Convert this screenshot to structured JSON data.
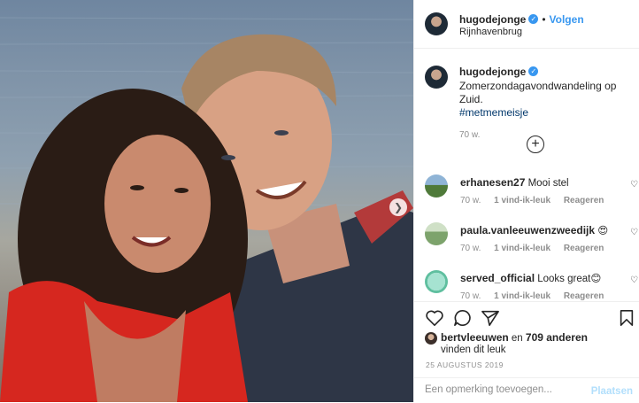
{
  "post": {
    "username": "hugodejonge",
    "verified": true,
    "follow_label": "Volgen",
    "location": "Rijnhavenbrug",
    "caption": "Zomerzondagavondwandeling op Zuid.",
    "hashtag": "#metmemeisje",
    "age": "70 w."
  },
  "comments": [
    {
      "username": "erhanesen27",
      "text": "Mooi stel",
      "age": "70 w.",
      "likes": "1 vind-ik-leuk",
      "reply": "Reageren",
      "avatar_color": "#5b7a4a"
    },
    {
      "username": "paula.vanleeuwenzweedijk",
      "text": "😍",
      "age": "70 w.",
      "likes": "1 vind-ik-leuk",
      "reply": "Reageren",
      "avatar_color": "#9bb38d"
    },
    {
      "username": "served_official",
      "text": "Looks great😊",
      "age": "70 w.",
      "likes": "1 vind-ik-leuk",
      "reply": "Reageren",
      "avatar_color": "#7fcfb6"
    }
  ],
  "likes": {
    "first_user": "bertvleeuwen",
    "joiner": "en",
    "others": "709 anderen",
    "suffix": "vinden dit leuk"
  },
  "date": "25 AUGUSTUS 2019",
  "comment_box": {
    "placeholder": "Een opmerking toevoegen...",
    "post_label": "Plaatsen"
  },
  "icons": {
    "like": "heart-icon",
    "comment": "comment-bubble-icon",
    "share": "paper-plane-icon",
    "save": "bookmark-icon",
    "load_more": "plus-circle-icon",
    "next": "chevron-right-icon"
  },
  "colors": {
    "accent": "#3897f0",
    "hashtag": "#00376b",
    "muted": "#8e8e8e",
    "post_disabled": "#b2dffc"
  }
}
